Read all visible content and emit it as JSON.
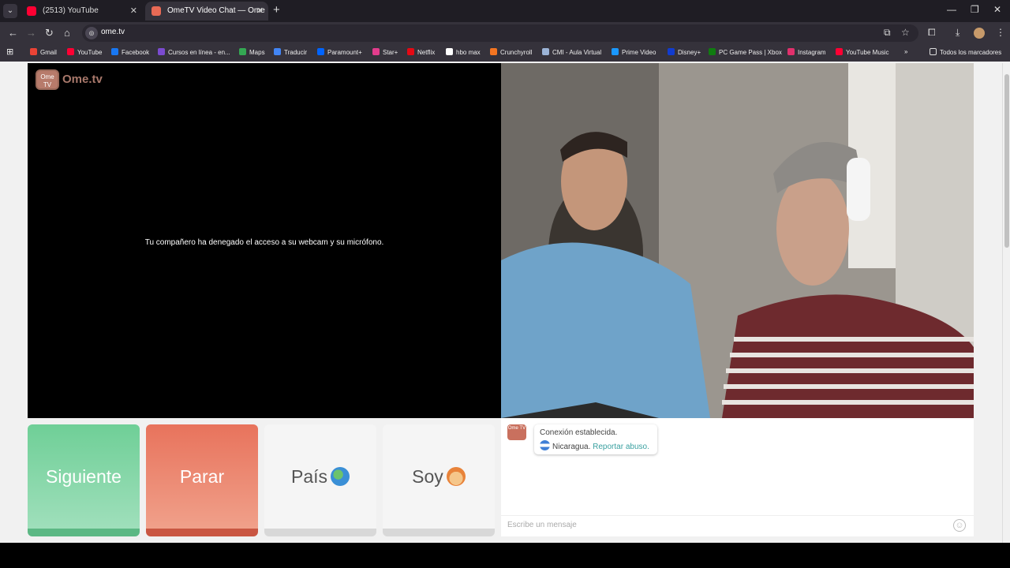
{
  "browser": {
    "tabs": [
      {
        "title": "(2513) YouTube",
        "color": "#ff0033"
      },
      {
        "title": "OmeTV Video Chat — Ome",
        "color": "#e86a55"
      }
    ],
    "address": "ome.tv",
    "icons": {
      "menu": "chevron-down-icon",
      "new_tab": "plus-icon"
    }
  },
  "bookmarks": [
    {
      "label": "Gmail",
      "color": "#ea4335"
    },
    {
      "label": "YouTube",
      "color": "#ff0033"
    },
    {
      "label": "Facebook",
      "color": "#1877f2"
    },
    {
      "label": "Cursos en línea - en...",
      "color": "#7b4bd0"
    },
    {
      "label": "Maps",
      "color": "#34a853"
    },
    {
      "label": "Traducir",
      "color": "#4285f4"
    },
    {
      "label": "Paramount+",
      "color": "#0064ff"
    },
    {
      "label": "Star+",
      "color": "#e23c8c"
    },
    {
      "label": "Netflix",
      "color": "#e50914"
    },
    {
      "label": "hbo max",
      "color": "#ffffff"
    },
    {
      "label": "Crunchyroll",
      "color": "#f47521"
    },
    {
      "label": "CMI - Aula Virtual",
      "color": "#9bb3d6"
    },
    {
      "label": "Prime Video",
      "color": "#1a98ff"
    },
    {
      "label": "Disney+",
      "color": "#113ccf"
    },
    {
      "label": "PC Game Pass | Xbox",
      "color": "#107c10"
    },
    {
      "label": "Instagram",
      "color": "#e1306c"
    },
    {
      "label": "YouTube Music",
      "color": "#ff0033"
    }
  ],
  "bookmarks_all": "Todos los marcadores",
  "logo": {
    "badge": "Ome TV",
    "text": "Ome.tv"
  },
  "video": {
    "notice": "Tu compañero ha denegado el acceso a su webcam y su micrófono."
  },
  "controls": {
    "next": "Siguiente",
    "stop": "Parar",
    "country": "País",
    "soy": "Soy"
  },
  "chat": {
    "status": "Conexión establecida.",
    "country": "Nicaragua.",
    "report": "Reportar abuso.",
    "placeholder": "Escribe un mensaje"
  },
  "colors": {
    "next": "#6fcf97",
    "stop": "#e8735c",
    "brand": "#c9705e"
  }
}
